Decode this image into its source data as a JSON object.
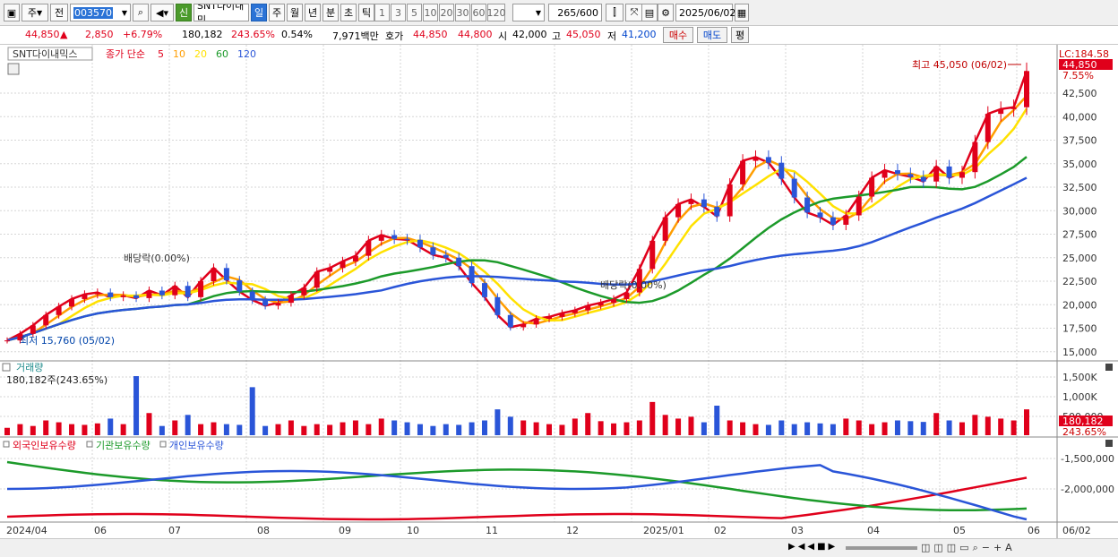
{
  "toolbar": {
    "period_unit": "주",
    "prev_label": "전",
    "code_value": "003570",
    "new_badge": "신",
    "stock_name": "SNT다이내믹",
    "period_tabs": [
      "일",
      "주",
      "월",
      "년",
      "분",
      "초",
      "틱"
    ],
    "active_period": "일",
    "ma_numbers": [
      "1",
      "3",
      "5",
      "10",
      "20",
      "30",
      "60",
      "120"
    ],
    "count_value": "265",
    "count_total": "/600",
    "date_value": "2025/06/02"
  },
  "quote": {
    "price": "44,850",
    "up_mark": "▲",
    "change": "2,850",
    "change_pct": "+6.79%",
    "volume": "180,182",
    "volume_ratio": "243.65%",
    "turnover": "0.54%",
    "amount": "7,971백만",
    "ask_label": "호가",
    "ask": "44,850",
    "bid": "44,800",
    "open_label": "시",
    "open": "42,000",
    "high_label": "고",
    "high": "45,050",
    "low_label": "저",
    "low": "41,200",
    "buy_button": "매수",
    "sell_button": "매도",
    "eval_button": "평"
  },
  "legend": {
    "stock": "SNT다이내믹스",
    "ma_prefix": "종가 단순",
    "ma_periods": [
      "5",
      "10",
      "20",
      "60",
      "120"
    ],
    "ma_colors": [
      "#e0001b",
      "#ff9d00",
      "#ffe100",
      "#1c9a2a",
      "#2a55d8"
    ]
  },
  "annotations": {
    "high_note": "최고 45,050 (06/02)",
    "low_note": "최저 15,760 (05/02)",
    "dividend1": "배당락(0.00%)",
    "dividend2": "배당락(0.00%)"
  },
  "axis_badges": {
    "lc": "LC:184.58",
    "price_now": "44,850",
    "pct_now": "7.55%",
    "vol_now": "180,182",
    "vol_pct": "243.65%"
  },
  "price_ticks": [
    "42,500",
    "40,000",
    "37,500",
    "35,000",
    "32,500",
    "30,000",
    "27,500",
    "25,000",
    "22,500",
    "20,000",
    "17,500",
    "15,000"
  ],
  "volume_panel": {
    "title": "거래량",
    "value": "180,182주(243.65%)",
    "ticks": [
      "1,500K",
      "1,000K",
      "500,000"
    ]
  },
  "holdings_panel": {
    "titles": [
      "외국인보유수량",
      "기관보유수량",
      "개인보유수량"
    ],
    "colors": [
      "#e0001b",
      "#1c9a2a",
      "#2a55d8"
    ],
    "ticks": [
      "-1,500,000",
      "-2,000,000"
    ]
  },
  "date_axis": [
    "2024/04",
    "06",
    "07",
    "08",
    "09",
    "10",
    "11",
    "12",
    "2025/01",
    "02",
    "03",
    "04",
    "05",
    "06"
  ],
  "date_axis_right": "06/02",
  "chart_data": {
    "type": "candlestick",
    "price_range": [
      14500,
      46500
    ],
    "closes": [
      16200,
      16900,
      17800,
      18900,
      19800,
      20600,
      21100,
      21300,
      20800,
      21000,
      20700,
      21500,
      21000,
      22000,
      20800,
      22500,
      23900,
      22600,
      21400,
      20500,
      19900,
      20200,
      21000,
      21800,
      23500,
      23900,
      24600,
      25200,
      26800,
      27400,
      27000,
      26900,
      26100,
      25300,
      25000,
      24100,
      22300,
      20800,
      18900,
      17600,
      17900,
      18500,
      18700,
      19100,
      19400,
      19900,
      20200,
      20600,
      21300,
      23800,
      26800,
      29300,
      30700,
      31200,
      30400,
      29400,
      32800,
      35300,
      35700,
      35100,
      33400,
      31400,
      29800,
      29300,
      28500,
      29500,
      31500,
      33500,
      34300,
      33900,
      33600,
      33100,
      34700,
      33500,
      34100,
      37300,
      40300,
      40800,
      41000,
      44850
    ],
    "volumes": [
      20,
      30,
      25,
      40,
      35,
      30,
      28,
      32,
      45,
      30,
      160,
      60,
      25,
      40,
      55,
      30,
      35,
      30,
      28,
      130,
      25,
      30,
      40,
      25,
      30,
      28,
      35,
      40,
      30,
      45,
      40,
      35,
      30,
      25,
      30,
      28,
      35,
      40,
      70,
      50,
      40,
      35,
      30,
      28,
      45,
      60,
      38,
      32,
      35,
      40,
      90,
      55,
      45,
      50,
      35,
      80,
      40,
      35,
      30,
      28,
      40,
      30,
      35,
      32,
      30,
      45,
      40,
      30,
      35,
      40,
      38,
      36,
      60,
      40,
      35,
      55,
      50,
      45,
      40,
      70
    ]
  }
}
